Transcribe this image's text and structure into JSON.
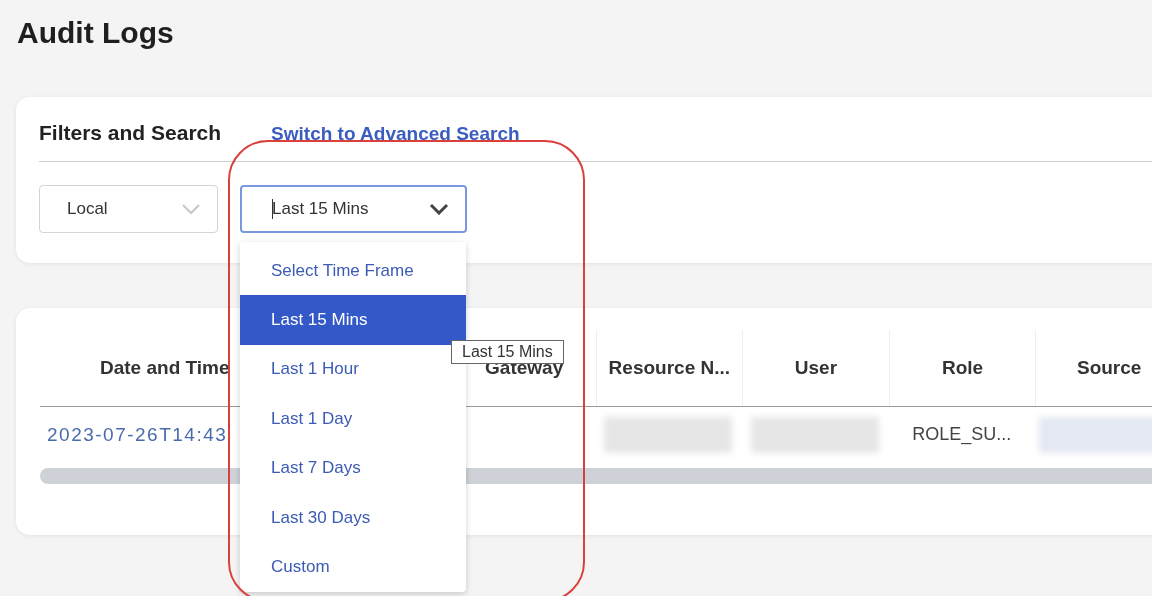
{
  "page": {
    "title": "Audit Logs"
  },
  "filters": {
    "title": "Filters and Search",
    "advanced_link": "Switch to Advanced Search",
    "timezone_select": {
      "value": "Local"
    },
    "time_frame_select": {
      "value": "Last 15 Mins",
      "expanded": true,
      "options": [
        {
          "label": "Select Time Frame",
          "selected": false
        },
        {
          "label": "Last 15 Mins",
          "selected": true
        },
        {
          "label": "Last 1 Hour",
          "selected": false
        },
        {
          "label": "Last 1 Day",
          "selected": false
        },
        {
          "label": "Last 7 Days",
          "selected": false
        },
        {
          "label": "Last 30 Days",
          "selected": false
        },
        {
          "label": "Custom",
          "selected": false
        }
      ]
    },
    "tooltip": "Last 15 Mins"
  },
  "table": {
    "columns": [
      "Date and Time",
      "Gateway",
      "Resource N...",
      "User",
      "Role",
      "Source"
    ],
    "rows": [
      {
        "cells": [
          {
            "kind": "link",
            "text": "2023-07-26T14:43"
          },
          {
            "kind": "empty"
          },
          {
            "kind": "redacted"
          },
          {
            "kind": "redacted"
          },
          {
            "kind": "text",
            "text": "ROLE_SU..."
          },
          {
            "kind": "redacted"
          }
        ]
      }
    ]
  }
}
